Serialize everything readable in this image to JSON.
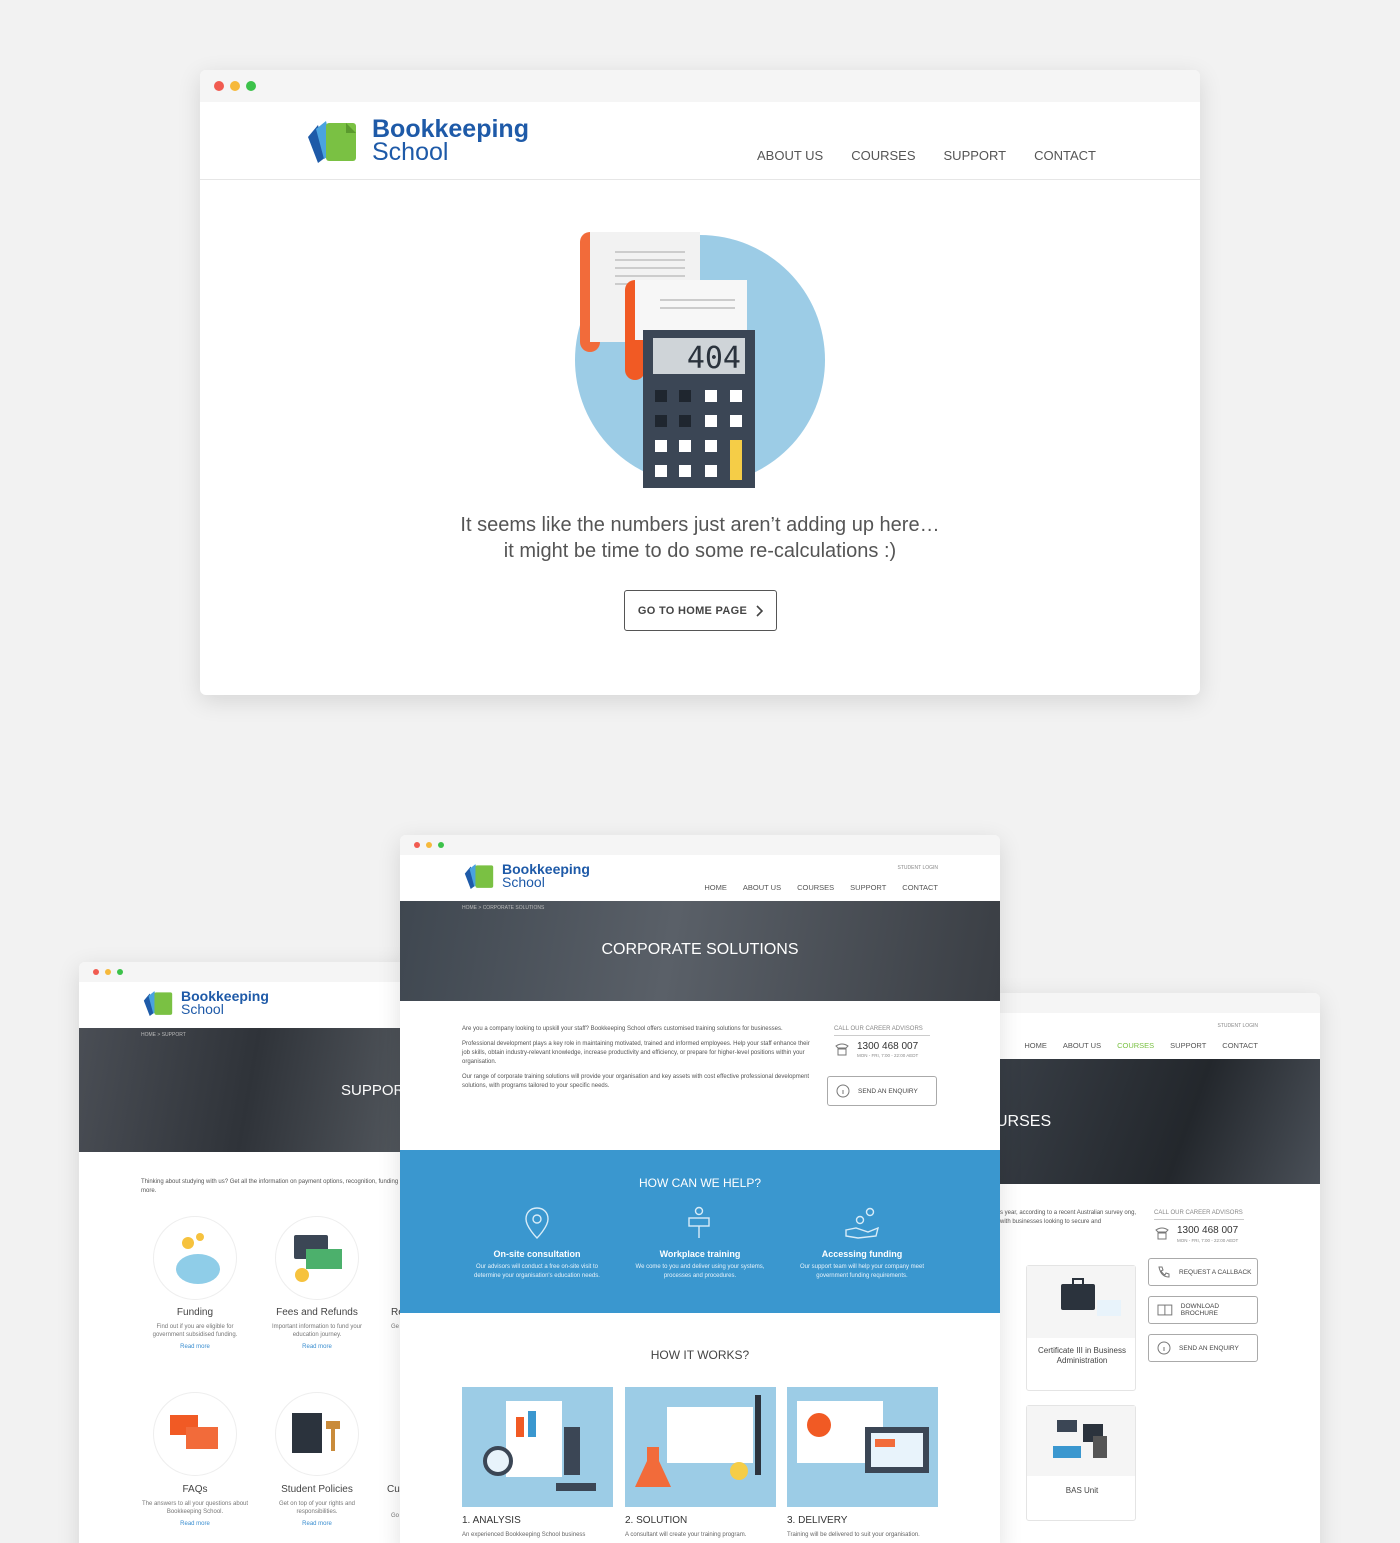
{
  "brand": {
    "name_line1": "Bookkeeping",
    "name_line2": "School",
    "color_blue": "#1e5aa8",
    "color_green": "#7ac143"
  },
  "main_window": {
    "nav": [
      "ABOUT US",
      "COURSES",
      "SUPPORT",
      "CONTACT"
    ],
    "error_code": "404",
    "message_line1": "It seems like the numbers just aren’t adding up here…",
    "message_line2": "it might be time to do some re-calculations :)",
    "home_button": "GO TO HOME PAGE"
  },
  "center_window": {
    "student_login": "STUDENT LOGIN",
    "nav": [
      "HOME",
      "ABOUT US",
      "COURSES",
      "SUPPORT",
      "CONTACT"
    ],
    "breadcrumb": "HOME  >  CORPORATE SOLUTIONS",
    "hero_title": "CORPORATE SOLUTIONS",
    "intro_p1": "Are you a company looking to upskill your staff? Bookkeeping School offers customised training solutions for businesses.",
    "intro_p2": "Professional development plays a key role in maintaining motivated, trained and informed employees. Help your staff enhance their job skills, obtain industry-relevant knowledge, increase productivity and efficiency, or prepare for higher-level positions within your organisation.",
    "intro_p3": "Our range of corporate training solutions will provide your organisation and key assets with cost effective professional development solutions, with programs tailored to your specific needs.",
    "call_label": "CALL OUR CAREER ADVISORS",
    "phone": "1300 468 007",
    "hours": "MON - FRI, 7:00 - 22:00 AEDT",
    "enquiry_button": "SEND AN ENQUIRY",
    "help_title": "HOW CAN WE HELP?",
    "help_color": "#3a97cf",
    "features": [
      {
        "title": "On-site consultation",
        "desc": "Our advisors will conduct a free on-site visit to determine your organisation's education needs.",
        "icon": "location-pin-icon"
      },
      {
        "title": "Workplace training",
        "desc": "We come to you and deliver using your systems, processes and procedures.",
        "icon": "presenter-icon"
      },
      {
        "title": "Accessing funding",
        "desc": "Our support team will help your company meet government funding requirements.",
        "icon": "hand-funding-icon"
      }
    ],
    "works_title": "HOW IT WORKS?",
    "steps": [
      {
        "title": "1. ANALYSIS",
        "desc": "An experienced Bookkeeping School business",
        "icon": "microscope-analysis-icon"
      },
      {
        "title": "2. SOLUTION",
        "desc": "A consultant will create your training program.",
        "icon": "flask-solution-icon"
      },
      {
        "title": "3. DELIVERY",
        "desc": "Training will be delivered to suit your organisation.",
        "icon": "monitor-delivery-icon"
      }
    ]
  },
  "left_window": {
    "breadcrumb": "HOME  >  SUPPORT",
    "hero_title": "SUPPORT",
    "intro": "Thinking about studying with us? Get all the information on payment options, recognition, funding and more.",
    "cards": [
      {
        "title": "Funding",
        "desc": "Find out if you are eligible for government subsidised funding.",
        "link": "Read more",
        "icon": "piggy-bank-icon"
      },
      {
        "title": "Fees and Refunds",
        "desc": "Important information to fund your education journey.",
        "link": "Read more",
        "icon": "credit-card-cash-icon"
      },
      {
        "title": "Re",
        "desc": "Ge le",
        "link": "",
        "icon": ""
      },
      {
        "title": "FAQs",
        "desc": "The answers to all your questions about Bookkeeping School.",
        "link": "Read more",
        "icon": "speech-bubbles-icon"
      },
      {
        "title": "Student Policies",
        "desc": "Get on top of your rights and responsibilities.",
        "link": "Read more",
        "icon": "book-gavel-icon"
      },
      {
        "title": "Cu",
        "desc": "Go",
        "link": "",
        "icon": ""
      }
    ]
  },
  "right_window": {
    "student_login": "STUDENT LOGIN",
    "nav": [
      "HOME",
      "ABOUT US",
      "COURSES",
      "SUPPORT",
      "CONTACT"
    ],
    "active_nav": "COURSES",
    "hero_title": "URSES",
    "intro": "s year, according to a recent Australian survey ong, with businesses looking to secure and",
    "call_label": "CALL OUR CAREER ADVISORS",
    "phone": "1300 468 007",
    "hours": "MON - FRI, 7:00 - 22:00 AEDT",
    "buttons": [
      "REQUEST A CALLBACK",
      "DOWNLOAD BROCHURE",
      "SEND AN ENQUIRY"
    ],
    "course_cards": [
      {
        "title": "Certificate III in Business Administration",
        "icon": "briefcase-icon"
      },
      {
        "title": "BAS Unit",
        "icon": "calculator-bas-icon"
      }
    ]
  }
}
